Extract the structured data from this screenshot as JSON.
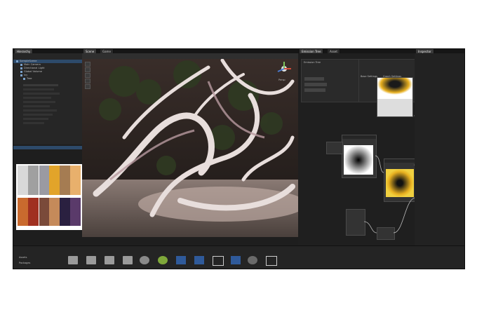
{
  "window": {
    "tabs": [
      "Hierarchy",
      "Scene",
      "Game",
      "Emission Tree",
      "Asset",
      "Inspector"
    ],
    "hierarchy_title": "Hierarchy"
  },
  "hierarchy": {
    "items": [
      "SampleScene",
      "Main Camera",
      "Directional Light",
      "Global Volume",
      "Ivy",
      "Tree"
    ]
  },
  "scene": {
    "persp_label": "Persp"
  },
  "graph": {
    "panel_title": "Emission Tree",
    "labels": [
      "Base Settings",
      "Graph Settings"
    ]
  },
  "bottom": {
    "labels": [
      "Assets",
      "Packages"
    ]
  },
  "colors": {
    "accent": "#2d4a6a",
    "palette": [
      "#d8d8d8",
      "#a0a0a0",
      "#e2a42a",
      "#f3c14a",
      "#a57c52",
      "#e8b06c",
      "#c96a2e",
      "#a03020",
      "#7a4a3a",
      "#c58a5a",
      "#2a2040",
      "#5a3a6a"
    ]
  }
}
